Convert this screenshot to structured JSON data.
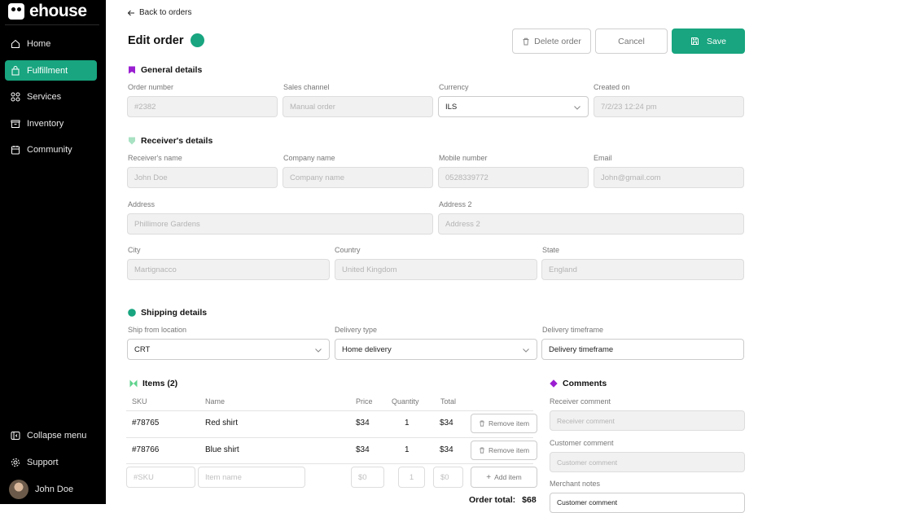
{
  "brand": {
    "name": "ehouse"
  },
  "sidebar": {
    "items": [
      {
        "label": "Home",
        "icon": "home-icon"
      },
      {
        "label": "Fulfillment",
        "icon": "bag-icon",
        "active": true
      },
      {
        "label": "Services",
        "icon": "grid-icon"
      },
      {
        "label": "Inventory",
        "icon": "box-icon"
      },
      {
        "label": "Community",
        "icon": "calendar-icon"
      }
    ],
    "collapse_label": "Collapse menu",
    "support_label": "Support",
    "user_name": "John Doe"
  },
  "header": {
    "back_label": "Back to orders",
    "title": "Edit order",
    "status_color": "#18a57f",
    "delete_label": "Delete order",
    "cancel_label": "Cancel",
    "save_label": "Save"
  },
  "general": {
    "title": "General details",
    "order_number": {
      "label": "Order number",
      "placeholder": "#2382"
    },
    "sales_channel": {
      "label": "Sales channel",
      "placeholder": "Manual order"
    },
    "currency": {
      "label": "Currency",
      "value": "ILS"
    },
    "created_on": {
      "label": "Created on",
      "placeholder": "7/2/23 12:24 pm"
    }
  },
  "receiver": {
    "title": "Receiver's details",
    "name": {
      "label": "Receiver's name",
      "placeholder": "John Doe"
    },
    "company": {
      "label": "Company name",
      "placeholder": "Company name"
    },
    "mobile": {
      "label": "Mobile number",
      "placeholder": "0528339772"
    },
    "email": {
      "label": "Email",
      "placeholder": "John@gmail.com"
    },
    "address": {
      "label": "Address",
      "placeholder": "Phillimore Gardens"
    },
    "address2": {
      "label": "Address 2",
      "placeholder": "Address 2"
    },
    "city": {
      "label": "City",
      "placeholder": "Martignacco"
    },
    "country": {
      "label": "Country",
      "placeholder": "United Kingdom"
    },
    "state": {
      "label": "State",
      "placeholder": "England"
    }
  },
  "shipping": {
    "title": "Shipping details",
    "ship_from": {
      "label": "Ship from location",
      "value": "CRT"
    },
    "delivery_type": {
      "label": "Delivery type",
      "value": "Home delivery"
    },
    "timeframe": {
      "label": "Delivery timeframe",
      "value": "Delivery timeframe"
    }
  },
  "items": {
    "title": "Items (2)",
    "columns": {
      "sku": "SKU",
      "name": "Name",
      "price": "Price",
      "quantity": "Quantity",
      "total": "Total"
    },
    "rows": [
      {
        "sku": "#78765",
        "name": "Red shirt",
        "price": "$34",
        "quantity": "1",
        "total": "$34",
        "remove_label": "Remove item"
      },
      {
        "sku": "#78766",
        "name": "Blue shirt",
        "price": "$34",
        "quantity": "1",
        "total": "$34",
        "remove_label": "Remove item"
      }
    ],
    "new_row": {
      "sku_placeholder": "#SKU",
      "name_placeholder": "Item name",
      "price_placeholder": "$0",
      "quantity_placeholder": "1",
      "total_placeholder": "$0",
      "add_label": "Add item"
    },
    "order_total_label": "Order total:",
    "order_total_value": "$68"
  },
  "comments": {
    "title": "Comments",
    "receiver": {
      "label": "Receiver comment",
      "placeholder": "Receiver comment"
    },
    "customer": {
      "label": "Customer comment",
      "placeholder": "Customer comment"
    },
    "merchant": {
      "label": "Merchant notes",
      "value": "Customer comment"
    }
  }
}
